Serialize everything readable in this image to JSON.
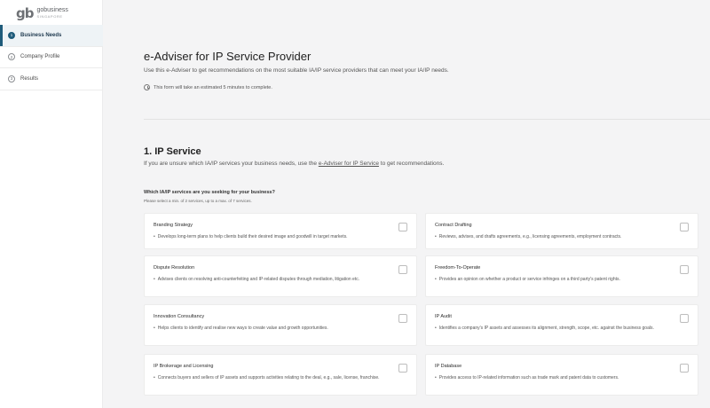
{
  "logo": {
    "mark": "gb",
    "line1": "gobusiness",
    "line2": "SINGAPORE"
  },
  "sidebar": {
    "steps": [
      {
        "num": "1",
        "label": "Business Needs"
      },
      {
        "num": "2",
        "label": "Company Profile"
      },
      {
        "num": "3",
        "label": "Results"
      }
    ]
  },
  "main": {
    "title": "e-Adviser for IP Service Provider",
    "subtitle": "Use this e-Adviser to get recommendations on the most suitable IA/IP service providers that can meet your IA/IP needs.",
    "estimate": "This form will take an estimated 5 minutes to complete."
  },
  "section": {
    "title": "1. IP Service",
    "sub_before": "If you are unsure which IA/IP services your business needs, use the ",
    "sub_link": "e-Adviser for IP Service",
    "sub_after": " to get recommendations.",
    "question": "Which IA/IP services are you seeking for your business?",
    "hint": "Please select a min. of 2 services, up to a max. of 7 services."
  },
  "services": [
    {
      "title": "Branding Strategy",
      "desc": "Develops long-term plans to help clients build their desired image and goodwill in target markets."
    },
    {
      "title": "Contract Drafting",
      "desc": "Reviews, advises, and drafts agreements, e.g., licensing agreements, employment contracts."
    },
    {
      "title": "Dispute Resolution",
      "desc": "Advises clients on resolving anti-counterfeiting and IP-related disputes through mediation, litigation etc."
    },
    {
      "title": "Freedom-To-Operate",
      "desc": "Provides an opinion on whether a product or service infringes on a third party's patent rights."
    },
    {
      "title": "Innovation Consultancy",
      "desc": "Helps clients to identify and realise new ways to create value and growth opportunities."
    },
    {
      "title": "IP Audit",
      "desc": "Identifies a company's IP assets and assesses its alignment, strength, scope, etc. against the business goals."
    },
    {
      "title": "IP Brokerage and Licensing",
      "desc": "Connects buyers and sellers of IP assets and supports activities relating to the deal, e.g., sale, license, franchise."
    },
    {
      "title": "IP Database",
      "desc": "Provides access to IP-related information such as trade mark and patent data to customers."
    }
  ]
}
